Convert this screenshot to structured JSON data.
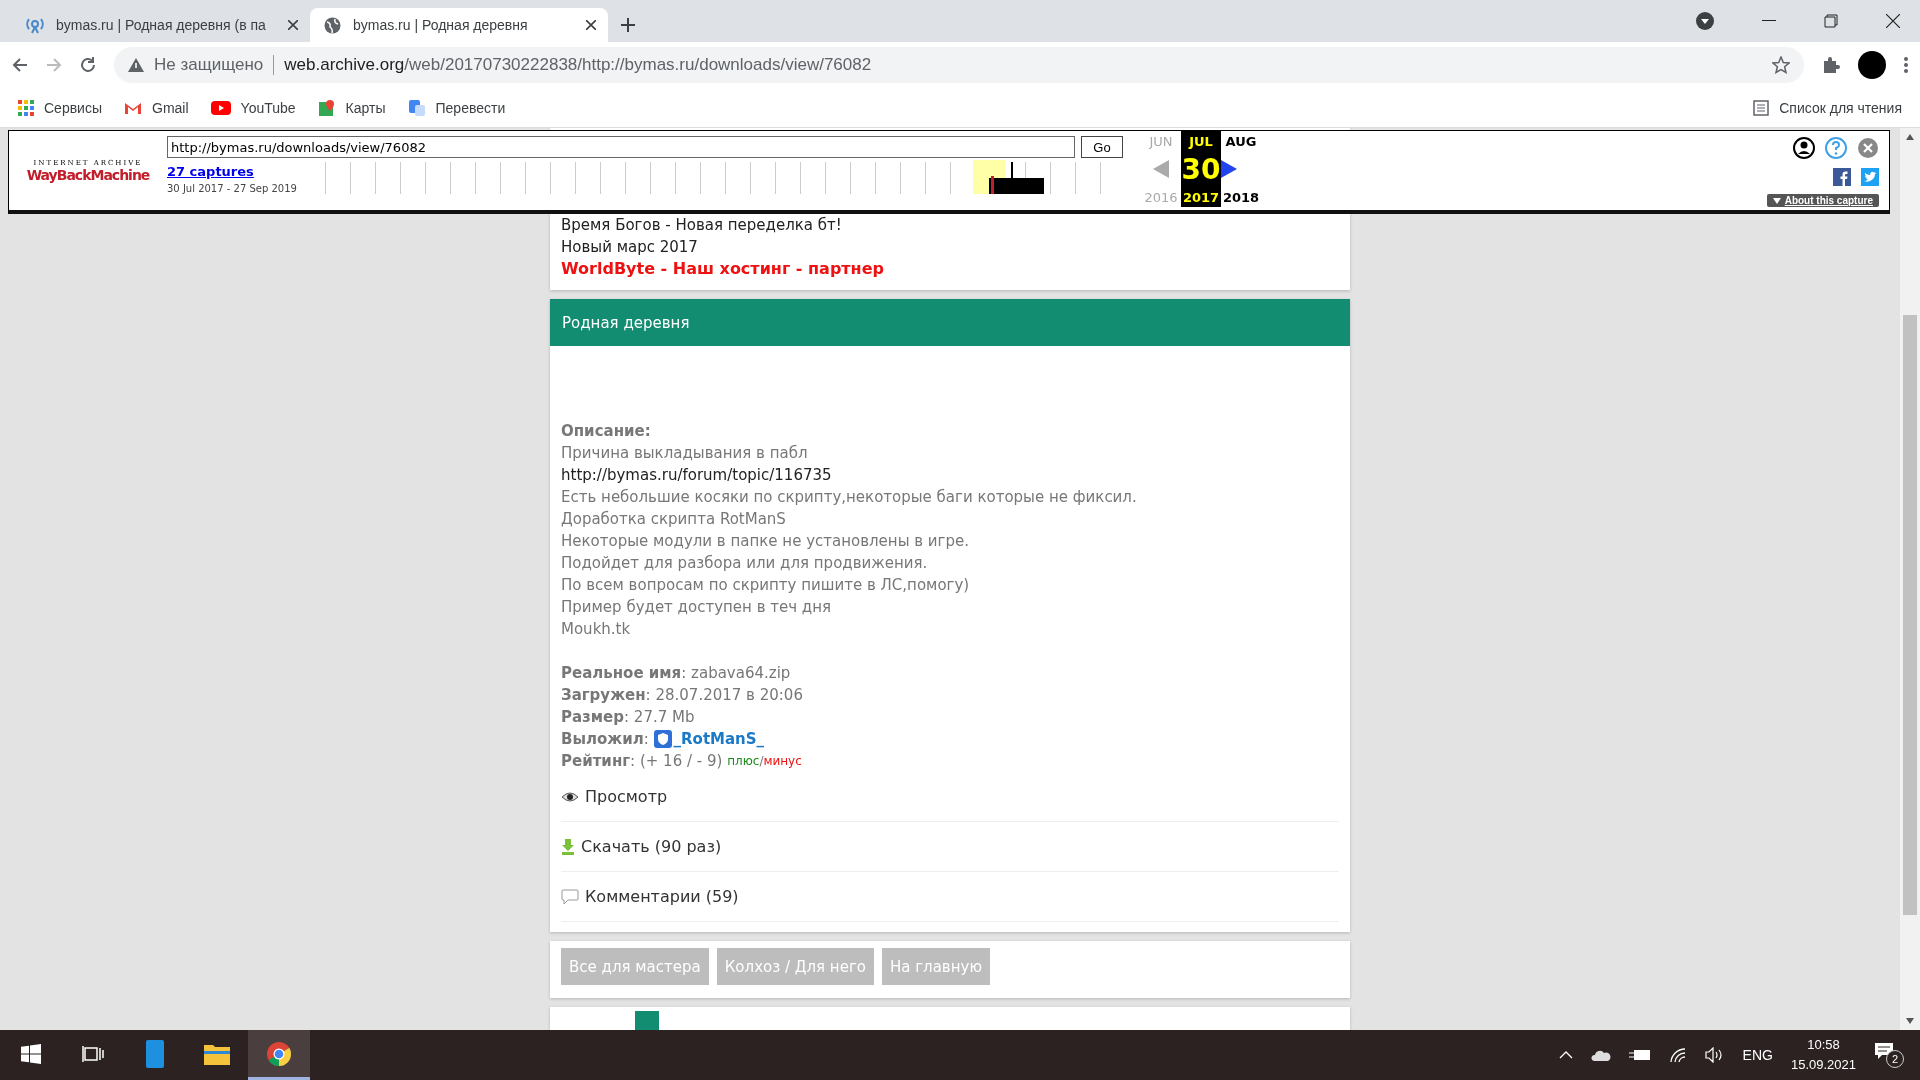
{
  "browser": {
    "tabs": [
      {
        "title": "bymas.ru | Родная деревня (в па",
        "kind": "archive",
        "selected": false
      },
      {
        "title": "bymas.ru | Родная деревня",
        "kind": "globe",
        "selected": true
      }
    ],
    "security_label": "Не защищено",
    "url_host": "web.archive.org",
    "url_path": "/web/20170730222838/http://bymas.ru/downloads/view/76082",
    "bookmarks": [
      {
        "label": "Сервисы",
        "kind": "apps"
      },
      {
        "label": "Gmail",
        "kind": "gmail"
      },
      {
        "label": "YouTube",
        "kind": "youtube"
      },
      {
        "label": "Карты",
        "kind": "maps"
      },
      {
        "label": "Перевести",
        "kind": "translate"
      }
    ],
    "reading_list": "Список для чтения"
  },
  "wayback": {
    "logo_top": "INTERNET ARCHIVE",
    "logo": "WayBackMachine",
    "url": "http://bymas.ru/downloads/view/76082",
    "go": "Go",
    "captures": "27 captures",
    "range": "30 Jul 2017 - 27 Sep 2019",
    "months": [
      {
        "label": "JUN",
        "selected": false,
        "disabled": true
      },
      {
        "label": "JUL",
        "selected": true,
        "disabled": false
      },
      {
        "label": "AUG",
        "selected": false,
        "disabled": false
      }
    ],
    "day": "30",
    "years": [
      {
        "label": "2016",
        "selected": false,
        "disabled": true
      },
      {
        "label": "2017",
        "selected": true,
        "disabled": false
      },
      {
        "label": "2018",
        "selected": false,
        "disabled": false
      }
    ],
    "about": "About this capture"
  },
  "page": {
    "top_links": [
      "Время Богов - Новая переделка бт!",
      "Новый марс 2017"
    ],
    "partner": "WorldByte - Наш хостинг - партнер",
    "file": {
      "title": "Родная деревня",
      "description_label": "Описание:",
      "description": [
        {
          "text": "Причина выкладывания в пабл",
          "kind": "text"
        },
        {
          "text": "http://bymas.ru/forum/topic/116735",
          "kind": "link"
        },
        {
          "text": "Есть небольшие косяки по скрипту,некоторые баги которые не фиксил.",
          "kind": "text"
        },
        {
          "text": "Доработка скрипта RotManS",
          "kind": "text"
        },
        {
          "text": "Некоторые модули в папке не установлены в игре.",
          "kind": "text"
        },
        {
          "text": "Подойдет для разбора или для продвижения.",
          "kind": "text"
        },
        {
          "text": "По всем вопросам по скрипту пишите в ЛС,помогу)",
          "kind": "text"
        },
        {
          "text": "Пример будет доступен в теч дня",
          "kind": "text"
        },
        {
          "text": "Moukh.tk",
          "kind": "text"
        }
      ],
      "meta": [
        {
          "label": "Реальное имя",
          "colon": ":",
          "value": "zabava64.zip",
          "kind": "text"
        },
        {
          "label": "Загружен",
          "colon": ":",
          "value": "28.07.2017 в 20:06",
          "kind": "text"
        },
        {
          "label": "Размер",
          "colon": ":",
          "value": "27.7 Mb",
          "kind": "text"
        },
        {
          "label": "Выложил",
          "colon": ":",
          "value": "_RotManS_",
          "kind": "user"
        }
      ],
      "rating": {
        "label": "Рейтинг",
        "colon": ":",
        "value": "(+ 16 / - 9)",
        "plus": "плюс",
        "separator": "/",
        "minus": "минус"
      },
      "actions": [
        {
          "label": "Просмотр",
          "kind": "view"
        },
        {
          "label": "Скачать (90 раз)",
          "kind": "download"
        },
        {
          "label": "Комментарии (59)",
          "kind": "comments"
        }
      ]
    },
    "nav_buttons": [
      "Все для мастера",
      "Колхоз / Для него",
      "На главную"
    ]
  },
  "taskbar": {
    "apps": [
      {
        "kind": "start",
        "selected": false
      },
      {
        "kind": "taskview",
        "selected": false
      },
      {
        "kind": "phone",
        "selected": false
      },
      {
        "kind": "explorer",
        "selected": false
      },
      {
        "kind": "chrome",
        "selected": true
      }
    ],
    "language": "ENG",
    "time": "10:58",
    "date": "15.09.2021",
    "notifications": "2"
  }
}
